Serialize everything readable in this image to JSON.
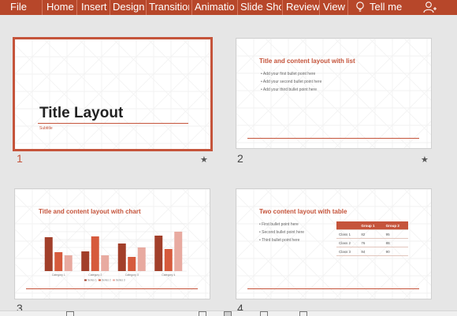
{
  "ribbon": {
    "tabs": [
      "File",
      "Home",
      "Insert",
      "Design",
      "Transitior",
      "Animatio",
      "Slide Sho",
      "Review",
      "View"
    ],
    "tell_me": "Tell me"
  },
  "slides": [
    {
      "number": "1",
      "title": "Title Layout",
      "subtitle": "Subtitle"
    },
    {
      "number": "2",
      "title": "Title and content layout with list",
      "bullets": [
        "Add your first bullet point here",
        "Add your second bullet point here",
        "Add your third bullet point here"
      ]
    },
    {
      "number": "3",
      "title": "Title and content layout with chart"
    },
    {
      "number": "4",
      "title": "Two content layout with table",
      "bullets": [
        "First bullet point here",
        "Second bullet point here",
        "Third bullet point here"
      ],
      "table": {
        "header": [
          "",
          "Group 1",
          "Group 2"
        ],
        "rows": [
          [
            "Class 1",
            "82",
            "95"
          ],
          [
            "Class 2",
            "76",
            "88"
          ],
          [
            "Class 3",
            "84",
            "90"
          ]
        ]
      }
    }
  ],
  "chart_data": {
    "type": "bar",
    "categories": [
      "Category 1",
      "Category 2",
      "Category 3",
      "Category 4"
    ],
    "series": [
      {
        "name": "Series 1",
        "color": "#a23f2a",
        "values": [
          4.3,
          2.5,
          3.5,
          4.5
        ]
      },
      {
        "name": "Series 2",
        "color": "#d65a3c",
        "values": [
          2.4,
          4.4,
          1.8,
          2.8
        ]
      },
      {
        "name": "Series 3",
        "color": "#e8aaa0",
        "values": [
          2.0,
          2.0,
          3.0,
          5.0
        ]
      }
    ],
    "ylim": [
      0,
      6
    ],
    "legend": "bottom"
  },
  "colors": {
    "accent": "#c5543b",
    "ribbon": "#b7472a"
  }
}
